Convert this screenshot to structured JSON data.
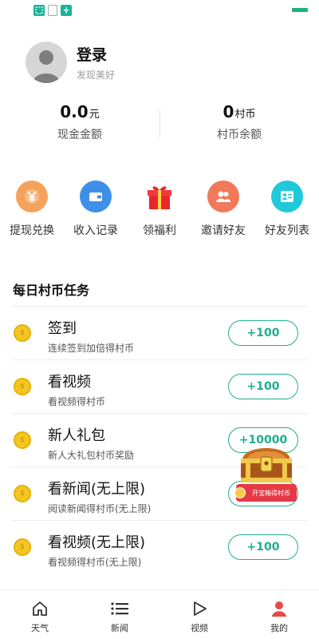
{
  "status_bar": {
    "icons": [
      "screenshot-icon",
      "clipboard-icon",
      "usb-icon"
    ],
    "battery_color": "#1fb07a"
  },
  "profile": {
    "login_label": "登录",
    "subtitle": "发现美好"
  },
  "balances": [
    {
      "amount": "0.0",
      "unit": "元",
      "label": "现金金额"
    },
    {
      "amount": "0",
      "unit": "村币",
      "label": "村币余额"
    }
  ],
  "shortcuts": [
    {
      "label": "提现兑换",
      "icon": "yen-icon",
      "color": "#f5a35c"
    },
    {
      "label": "收入记录",
      "icon": "wallet-icon",
      "color": "#3d8fe8"
    },
    {
      "label": "领福利",
      "icon": "gift-icon",
      "color": "#e8262c"
    },
    {
      "label": "邀请好友",
      "icon": "invite-friends-icon",
      "color": "#f2795a"
    },
    {
      "label": "好友列表",
      "icon": "friend-list-icon",
      "color": "#1fc9d9"
    }
  ],
  "tasks_section": {
    "title": "每日村币任务",
    "tasks": [
      {
        "title": "签到",
        "desc": "连续签到加倍得村币",
        "reward": "+100"
      },
      {
        "title": "看视频",
        "desc": "看视频得村币",
        "reward": "+100"
      },
      {
        "title": "新人礼包",
        "desc": "新人大礼包村币奖励",
        "reward": "+10000"
      },
      {
        "title": "看新闻(无上限)",
        "desc": "阅读新闻得村币(无上限)",
        "reward": "+100"
      },
      {
        "title": "看视频(无上限)",
        "desc": "看视频得村币(无上限)",
        "reward": "+100"
      }
    ]
  },
  "treasure_box": {
    "label": "开宝箱得村币"
  },
  "bottom_nav": [
    {
      "label": "天气",
      "icon": "home-icon",
      "active": false
    },
    {
      "label": "新闻",
      "icon": "list-icon",
      "active": false
    },
    {
      "label": "视频",
      "icon": "play-icon",
      "active": false
    },
    {
      "label": "我的",
      "icon": "person-icon",
      "active": true
    }
  ],
  "colors": {
    "accent": "#1fae8e",
    "coin": "#f3c623",
    "active_nav": "#e84a4a"
  }
}
